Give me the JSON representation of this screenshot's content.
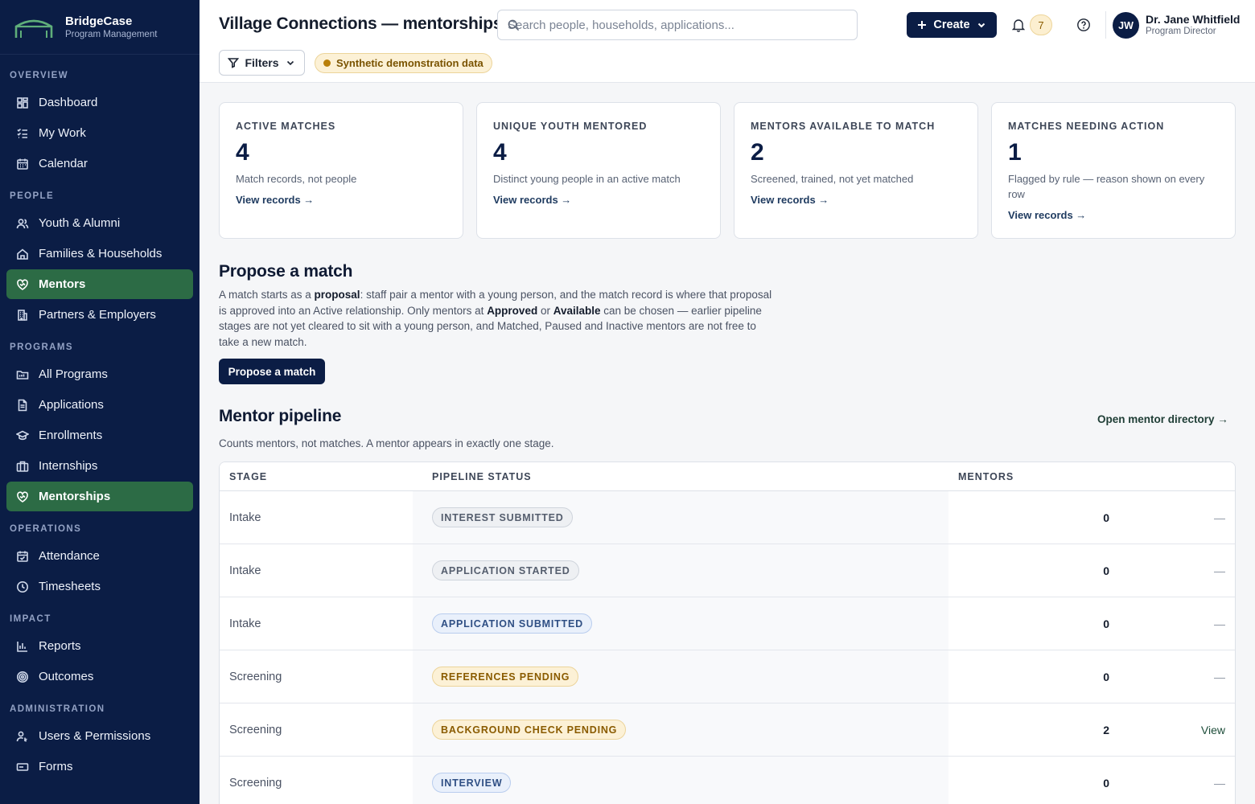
{
  "brand": {
    "name": "BridgeCase",
    "subtitle": "Program Management"
  },
  "sidebar": {
    "sections": [
      {
        "label": "OVERVIEW",
        "items": [
          {
            "label": "Dashboard",
            "icon": "dashboard-icon",
            "active": false
          },
          {
            "label": "My Work",
            "icon": "checklist-icon",
            "active": false
          },
          {
            "label": "Calendar",
            "icon": "calendar-icon",
            "active": false
          }
        ]
      },
      {
        "label": "PEOPLE",
        "items": [
          {
            "label": "Youth & Alumni",
            "icon": "users-icon",
            "active": false
          },
          {
            "label": "Families & Households",
            "icon": "home-icon",
            "active": false
          },
          {
            "label": "Mentors",
            "icon": "handshake-heart-icon",
            "active": true
          },
          {
            "label": "Partners & Employers",
            "icon": "building-icon",
            "active": false
          }
        ]
      },
      {
        "label": "PROGRAMS",
        "items": [
          {
            "label": "All Programs",
            "icon": "folder-icon",
            "active": false
          },
          {
            "label": "Applications",
            "icon": "document-icon",
            "active": false
          },
          {
            "label": "Enrollments",
            "icon": "graduation-cap-icon",
            "active": false
          },
          {
            "label": "Internships",
            "icon": "briefcase-icon",
            "active": false
          },
          {
            "label": "Mentorships",
            "icon": "handshake-heart-icon",
            "active": true
          }
        ]
      },
      {
        "label": "OPERATIONS",
        "items": [
          {
            "label": "Attendance",
            "icon": "calendar-check-icon",
            "active": false
          },
          {
            "label": "Timesheets",
            "icon": "clock-icon",
            "active": false
          }
        ]
      },
      {
        "label": "IMPACT",
        "items": [
          {
            "label": "Reports",
            "icon": "bar-chart-icon",
            "active": false
          },
          {
            "label": "Outcomes",
            "icon": "target-icon",
            "active": false
          }
        ]
      },
      {
        "label": "ADMINISTRATION",
        "items": [
          {
            "label": "Users & Permissions",
            "icon": "user-key-icon",
            "active": false
          },
          {
            "label": "Forms",
            "icon": "form-icon",
            "active": false
          }
        ]
      }
    ]
  },
  "header": {
    "title": "Village Connections — mentorships",
    "search_placeholder": "Search people, households, applications...",
    "create_label": "Create",
    "notification_count": "7",
    "user": {
      "initials": "JW",
      "name": "Dr. Jane Whitfield",
      "role": "Program Director"
    },
    "filters_label": "Filters",
    "demo_badge": "Synthetic demonstration data"
  },
  "stats": [
    {
      "label": "ACTIVE MATCHES",
      "value": "4",
      "desc": "Match records, not people",
      "link": "View records →"
    },
    {
      "label": "UNIQUE YOUTH MENTORED",
      "value": "4",
      "desc": "Distinct young people in an active match",
      "link": "View records →"
    },
    {
      "label": "MENTORS AVAILABLE TO MATCH",
      "value": "2",
      "desc": "Screened, trained, not yet matched",
      "link": "View records →"
    },
    {
      "label": "MATCHES NEEDING ACTION",
      "value": "1",
      "desc": "Flagged by rule — reason shown on every row",
      "link": "View records →"
    }
  ],
  "propose": {
    "title": "Propose a match",
    "text_1": "A match starts as a ",
    "text_bold_1": "proposal",
    "text_2": ": staff pair a mentor with a young person, and the match record is where that proposal is approved into an Active relationship. Only mentors at ",
    "text_bold_2": "Approved",
    "text_3": " or ",
    "text_bold_3": "Available",
    "text_4": " can be chosen — earlier pipeline stages are not yet cleared to sit with a young person, and Matched, Paused and Inactive mentors are not free to take a new match.",
    "button": "Propose a match"
  },
  "pipeline": {
    "title": "Mentor pipeline",
    "directory_link": "Open mentor directory →",
    "subtitle": "Counts mentors, not matches. A mentor appears in exactly one stage.",
    "columns": {
      "stage": "STAGE",
      "status": "PIPELINE STATUS",
      "mentors": "MENTORS"
    },
    "rows": [
      {
        "stage": "Intake",
        "status": "INTEREST SUBMITTED",
        "tone": "gray",
        "mentors": "0",
        "action": "—"
      },
      {
        "stage": "Intake",
        "status": "APPLICATION STARTED",
        "tone": "gray",
        "mentors": "0",
        "action": "—"
      },
      {
        "stage": "Intake",
        "status": "APPLICATION SUBMITTED",
        "tone": "blue",
        "mentors": "0",
        "action": "—"
      },
      {
        "stage": "Screening",
        "status": "REFERENCES PENDING",
        "tone": "amber",
        "mentors": "0",
        "action": "—"
      },
      {
        "stage": "Screening",
        "status": "BACKGROUND CHECK PENDING",
        "tone": "amber",
        "mentors": "2",
        "action": "View"
      },
      {
        "stage": "Screening",
        "status": "INTERVIEW",
        "tone": "blue",
        "mentors": "0",
        "action": "—"
      }
    ]
  }
}
